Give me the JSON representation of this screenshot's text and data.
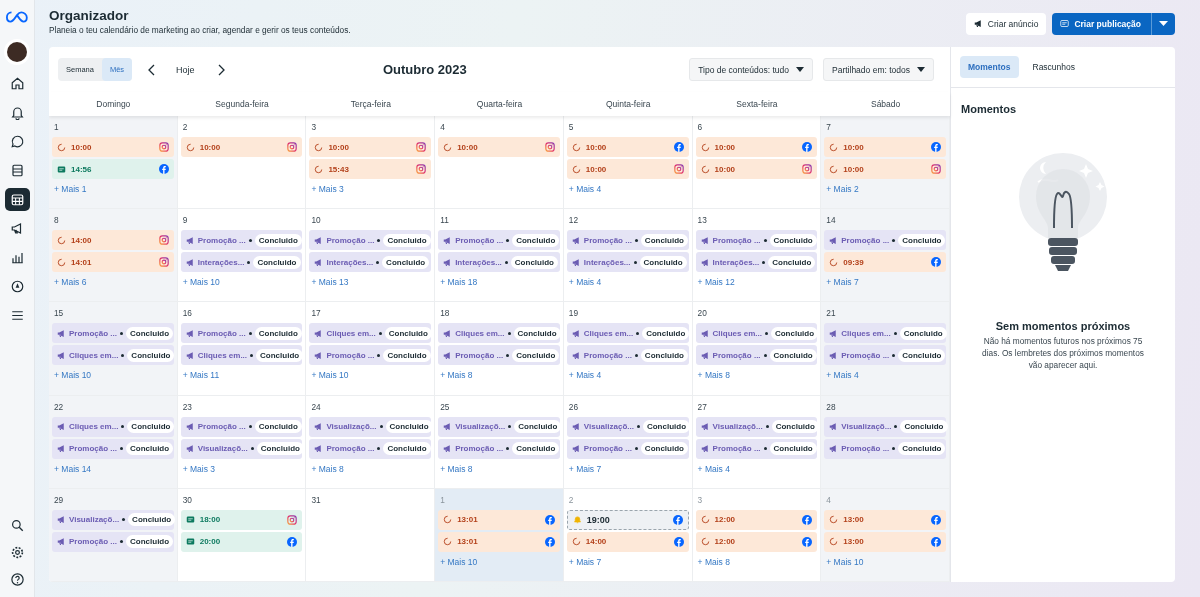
{
  "sidebar": {
    "items": [
      {
        "kind": "home",
        "selected": false
      },
      {
        "kind": "bell",
        "selected": false
      },
      {
        "kind": "chat",
        "selected": false
      },
      {
        "kind": "pages",
        "selected": false
      },
      {
        "kind": "calendar",
        "selected": true
      },
      {
        "kind": "megaphone",
        "selected": false
      },
      {
        "kind": "chart",
        "selected": false
      },
      {
        "kind": "compass",
        "selected": false
      },
      {
        "kind": "menu",
        "selected": false
      }
    ],
    "bottom": [
      {
        "kind": "search",
        "selected": false
      },
      {
        "kind": "gear",
        "selected": false
      },
      {
        "kind": "help",
        "selected": false
      }
    ]
  },
  "header": {
    "title": "Organizador",
    "subtitle": "Planeia o teu calendário de marketing ao criar, agendar e gerir os teus conteúdos.",
    "secondary_button": "Criar anúncio",
    "primary_button": "Criar publicação"
  },
  "toolbar": {
    "views": [
      {
        "label": "Semana",
        "selected": false
      },
      {
        "label": "Mês",
        "selected": true
      }
    ],
    "today": "Hoje",
    "month": "Outubro 2023",
    "filters": [
      "Tipo de conteúdos: tudo",
      "Partilhado em: todos"
    ]
  },
  "weekdays": [
    {
      "label": "Domingo",
      "weekend": true
    },
    {
      "label": "Segunda-feira",
      "weekend": false
    },
    {
      "label": "Terça-feira",
      "weekend": false
    },
    {
      "label": "Quarta-feira",
      "weekend": false
    },
    {
      "label": "Quinta-feira",
      "weekend": false
    },
    {
      "label": "Sexta-feira",
      "weekend": false
    },
    {
      "label": "Sábado",
      "weekend": true
    }
  ],
  "days": [
    {
      "day": "1",
      "other_month": false,
      "today": false,
      "events": [
        {
          "kind": "scheduled",
          "time": "10:00",
          "network": {
            "kind": "instagram"
          }
        },
        {
          "kind": "published",
          "time": "14:56",
          "network": {
            "kind": "facebook"
          }
        }
      ],
      "more": "+ Mais 1"
    },
    {
      "day": "2",
      "other_month": false,
      "today": false,
      "events": [
        {
          "kind": "scheduled",
          "time": "10:00",
          "network": {
            "kind": "instagram"
          }
        }
      ]
    },
    {
      "day": "3",
      "other_month": false,
      "today": false,
      "events": [
        {
          "kind": "scheduled",
          "time": "10:00",
          "network": {
            "kind": "instagram"
          }
        },
        {
          "kind": "scheduled",
          "time": "15:43",
          "network": {
            "kind": "instagram"
          }
        }
      ],
      "more": "+ Mais 3"
    },
    {
      "day": "4",
      "other_month": false,
      "today": false,
      "events": [
        {
          "kind": "scheduled",
          "time": "10:00",
          "network": {
            "kind": "instagram"
          }
        }
      ]
    },
    {
      "day": "5",
      "other_month": false,
      "today": false,
      "events": [
        {
          "kind": "scheduled",
          "time": "10:00",
          "network": {
            "kind": "facebook"
          }
        },
        {
          "kind": "scheduled",
          "time": "10:00",
          "network": {
            "kind": "instagram"
          }
        }
      ],
      "more": "+ Mais 4"
    },
    {
      "day": "6",
      "other_month": false,
      "today": false,
      "events": [
        {
          "kind": "scheduled",
          "time": "10:00",
          "network": {
            "kind": "facebook"
          }
        },
        {
          "kind": "scheduled",
          "time": "10:00",
          "network": {
            "kind": "instagram"
          }
        }
      ]
    },
    {
      "day": "7",
      "other_month": false,
      "today": false,
      "events": [
        {
          "kind": "scheduled",
          "time": "10:00",
          "network": {
            "kind": "facebook"
          }
        },
        {
          "kind": "scheduled",
          "time": "10:00",
          "network": {
            "kind": "instagram"
          }
        }
      ],
      "more": "+ Mais 2"
    },
    {
      "day": "8",
      "other_month": false,
      "today": false,
      "events": [
        {
          "kind": "scheduled",
          "time": "14:00",
          "network": {
            "kind": "instagram"
          }
        },
        {
          "kind": "scheduled",
          "time": "14:01",
          "network": {
            "kind": "instagram"
          }
        }
      ],
      "more": "+ Mais 6"
    },
    {
      "day": "9",
      "other_month": false,
      "today": false,
      "events": [
        {
          "kind": "ad",
          "title": "Promoção ...",
          "status": "Concluido"
        },
        {
          "kind": "ad",
          "title": "Interações...",
          "status": "Concluido"
        }
      ],
      "more": "+ Mais 10"
    },
    {
      "day": "10",
      "other_month": false,
      "today": false,
      "events": [
        {
          "kind": "ad",
          "title": "Promoção ...",
          "status": "Concluido"
        },
        {
          "kind": "ad",
          "title": "Interações...",
          "status": "Concluido"
        }
      ],
      "more": "+ Mais 13"
    },
    {
      "day": "11",
      "other_month": false,
      "today": false,
      "events": [
        {
          "kind": "ad",
          "title": "Promoção ...",
          "status": "Concluido"
        },
        {
          "kind": "ad",
          "title": "Interações...",
          "status": "Concluido"
        }
      ],
      "more": "+ Mais 18"
    },
    {
      "day": "12",
      "other_month": false,
      "today": false,
      "events": [
        {
          "kind": "ad",
          "title": "Promoção ...",
          "status": "Concluido"
        },
        {
          "kind": "ad",
          "title": "Interações...",
          "status": "Concluido"
        }
      ],
      "more": "+ Mais 4"
    },
    {
      "day": "13",
      "other_month": false,
      "today": false,
      "events": [
        {
          "kind": "ad",
          "title": "Promoção ...",
          "status": "Concluido"
        },
        {
          "kind": "ad",
          "title": "Interações...",
          "status": "Concluido"
        }
      ],
      "more": "+ Mais 12"
    },
    {
      "day": "14",
      "other_month": false,
      "today": false,
      "events": [
        {
          "kind": "ad",
          "title": "Promoção ...",
          "status": "Concluido"
        },
        {
          "kind": "scheduled",
          "time": "09:39",
          "network": {
            "kind": "facebook"
          }
        }
      ],
      "more": "+ Mais 7"
    },
    {
      "day": "15",
      "other_month": false,
      "today": false,
      "events": [
        {
          "kind": "ad",
          "title": "Promoção ...",
          "status": "Concluido"
        },
        {
          "kind": "ad",
          "title": "Cliques em...",
          "status": "Concluido"
        }
      ],
      "more": "+ Mais 10"
    },
    {
      "day": "16",
      "other_month": false,
      "today": false,
      "events": [
        {
          "kind": "ad",
          "title": "Promoção ...",
          "status": "Concluido"
        },
        {
          "kind": "ad",
          "title": "Cliques em...",
          "status": "Concluido"
        }
      ],
      "more": "+ Mais 11"
    },
    {
      "day": "17",
      "other_month": false,
      "today": false,
      "events": [
        {
          "kind": "ad",
          "title": "Cliques em...",
          "status": "Concluido"
        },
        {
          "kind": "ad",
          "title": "Promoção ...",
          "status": "Concluido"
        }
      ],
      "more": "+ Mais 10"
    },
    {
      "day": "18",
      "other_month": false,
      "today": false,
      "events": [
        {
          "kind": "ad",
          "title": "Cliques em...",
          "status": "Concluido"
        },
        {
          "kind": "ad",
          "title": "Promoção ...",
          "status": "Concluido"
        }
      ],
      "more": "+ Mais 8"
    },
    {
      "day": "19",
      "other_month": false,
      "today": false,
      "events": [
        {
          "kind": "ad",
          "title": "Cliques em...",
          "status": "Concluido"
        },
        {
          "kind": "ad",
          "title": "Promoção ...",
          "status": "Concluido"
        }
      ],
      "more": "+ Mais 4"
    },
    {
      "day": "20",
      "other_month": false,
      "today": false,
      "events": [
        {
          "kind": "ad",
          "title": "Cliques em...",
          "status": "Concluido"
        },
        {
          "kind": "ad",
          "title": "Promoção ...",
          "status": "Concluido"
        }
      ],
      "more": "+ Mais 8"
    },
    {
      "day": "21",
      "other_month": false,
      "today": false,
      "events": [
        {
          "kind": "ad",
          "title": "Cliques em...",
          "status": "Concluido"
        },
        {
          "kind": "ad",
          "title": "Promoção ...",
          "status": "Concluido"
        }
      ],
      "more": "+ Mais 4"
    },
    {
      "day": "22",
      "other_month": false,
      "today": false,
      "events": [
        {
          "kind": "ad",
          "title": "Cliques em...",
          "status": "Concluido"
        },
        {
          "kind": "ad",
          "title": "Promoção ...",
          "status": "Concluido"
        }
      ],
      "more": "+ Mais 14"
    },
    {
      "day": "23",
      "other_month": false,
      "today": false,
      "events": [
        {
          "kind": "ad",
          "title": "Promoção ...",
          "status": "Concluido"
        },
        {
          "kind": "ad",
          "title": "Visualizaçõ...",
          "status": "Concluido"
        }
      ],
      "more": "+ Mais 3"
    },
    {
      "day": "24",
      "other_month": false,
      "today": false,
      "events": [
        {
          "kind": "ad",
          "title": "Visualizaçõ...",
          "status": "Concluido"
        },
        {
          "kind": "ad",
          "title": "Promoção ...",
          "status": "Concluido"
        }
      ],
      "more": "+ Mais 8"
    },
    {
      "day": "25",
      "other_month": false,
      "today": false,
      "events": [
        {
          "kind": "ad",
          "title": "Visualizaçõ...",
          "status": "Concluido"
        },
        {
          "kind": "ad",
          "title": "Promoção ...",
          "status": "Concluido"
        }
      ],
      "more": "+ Mais 8"
    },
    {
      "day": "26",
      "other_month": false,
      "today": false,
      "events": [
        {
          "kind": "ad",
          "title": "Visualizaçõ...",
          "status": "Concluido"
        },
        {
          "kind": "ad",
          "title": "Promoção ...",
          "status": "Concluido"
        }
      ],
      "more": "+ Mais 7"
    },
    {
      "day": "27",
      "other_month": false,
      "today": false,
      "events": [
        {
          "kind": "ad",
          "title": "Visualizaçõ...",
          "status": "Concluido"
        },
        {
          "kind": "ad",
          "title": "Promoção ...",
          "status": "Concluido"
        }
      ],
      "more": "+ Mais 4"
    },
    {
      "day": "28",
      "other_month": false,
      "today": false,
      "events": [
        {
          "kind": "ad",
          "title": "Visualizaçõ...",
          "status": "Concluido"
        },
        {
          "kind": "ad",
          "title": "Promoção ...",
          "status": "Concluido"
        }
      ]
    },
    {
      "day": "29",
      "other_month": false,
      "today": false,
      "events": [
        {
          "kind": "ad",
          "title": "Visualizaçõ...",
          "status": "Concluido"
        },
        {
          "kind": "ad",
          "title": "Promoção ...",
          "status": "Concluido"
        }
      ]
    },
    {
      "day": "30",
      "other_month": false,
      "today": false,
      "events": [
        {
          "kind": "published",
          "time": "18:00",
          "network": {
            "kind": "instagram"
          }
        },
        {
          "kind": "published",
          "time": "20:00",
          "network": {
            "kind": "facebook"
          }
        }
      ]
    },
    {
      "day": "31",
      "other_month": false,
      "today": false
    },
    {
      "day": "1",
      "other_month": true,
      "today": true,
      "events": [
        {
          "kind": "scheduled",
          "time": "13:01",
          "network": {
            "kind": "facebook"
          }
        },
        {
          "kind": "scheduled",
          "time": "13:01",
          "network": {
            "kind": "facebook"
          }
        }
      ],
      "more": "+ Mais 10"
    },
    {
      "day": "2",
      "other_month": true,
      "today": false,
      "events": [
        {
          "kind": "draft",
          "time": "19:00",
          "network": {
            "kind": "facebook"
          }
        },
        {
          "kind": "scheduled",
          "time": "14:00",
          "network": {
            "kind": "facebook"
          }
        }
      ],
      "more": "+ Mais 7"
    },
    {
      "day": "3",
      "other_month": true,
      "today": false,
      "events": [
        {
          "kind": "scheduled",
          "time": "12:00",
          "network": {
            "kind": "facebook"
          }
        },
        {
          "kind": "scheduled",
          "time": "12:00",
          "network": {
            "kind": "facebook"
          }
        }
      ],
      "more": "+ Mais 8"
    },
    {
      "day": "4",
      "other_month": true,
      "today": false,
      "events": [
        {
          "kind": "scheduled",
          "time": "13:00",
          "network": {
            "kind": "facebook"
          }
        },
        {
          "kind": "scheduled",
          "time": "13:00",
          "network": {
            "kind": "facebook"
          }
        }
      ],
      "more": "+ Mais 10"
    }
  ],
  "panel": {
    "tabs": [
      {
        "label": "Momentos",
        "selected": true
      },
      {
        "label": "Rascunhos",
        "selected": false
      }
    ],
    "heading": "Momentos",
    "empty_title": "Sem momentos próximos",
    "empty_text": "Não há momentos futuros nos próximos 75 dias. Os lembretes dos próximos momentos vão aparecer aqui."
  }
}
